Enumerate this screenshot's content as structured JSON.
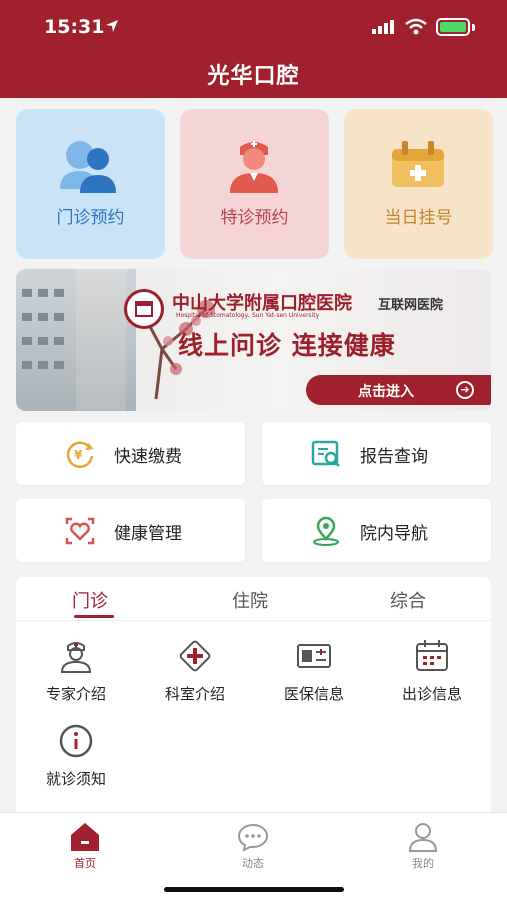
{
  "status_bar": {
    "time": "15:31"
  },
  "header": {
    "title": "光华口腔"
  },
  "top_cards": [
    {
      "label": "门诊预约",
      "icon": "doctor-group-icon"
    },
    {
      "label": "特诊预约",
      "icon": "nurse-icon"
    },
    {
      "label": "当日挂号",
      "icon": "medical-kit-icon"
    }
  ],
  "banner": {
    "hospital_name": "中山大学附属口腔医院",
    "hospital_name_en": "Hospital of Stomatology, Sun Yat-sen University",
    "subtitle": "互联网医院",
    "slogan": "线上问诊 连接健康",
    "cta": "点击进入"
  },
  "services": [
    {
      "label": "快速缴费",
      "icon": "payment-icon"
    },
    {
      "label": "报告查询",
      "icon": "report-search-icon"
    },
    {
      "label": "健康管理",
      "icon": "health-heart-icon"
    },
    {
      "label": "院内导航",
      "icon": "location-icon"
    }
  ],
  "info_tabs": [
    {
      "label": "门诊",
      "active": true
    },
    {
      "label": "住院",
      "active": false
    },
    {
      "label": "综合",
      "active": false
    }
  ],
  "grid_items": [
    {
      "label": "专家介绍",
      "icon": "doctor-icon"
    },
    {
      "label": "科室介绍",
      "icon": "department-icon"
    },
    {
      "label": "医保信息",
      "icon": "insurance-card-icon"
    },
    {
      "label": "出诊信息",
      "icon": "calendar-icon"
    },
    {
      "label": "就诊须知",
      "icon": "info-icon"
    }
  ],
  "tabbar": [
    {
      "label": "首页",
      "icon": "home-icon",
      "active": true
    },
    {
      "label": "动态",
      "icon": "chat-icon",
      "active": false
    },
    {
      "label": "我的",
      "icon": "user-icon",
      "active": false
    }
  ],
  "colors": {
    "brand": "#a0202e",
    "accent_blue": "#2d75c0",
    "accent_orange": "#c0852e",
    "accent_teal": "#2aa7a0"
  }
}
